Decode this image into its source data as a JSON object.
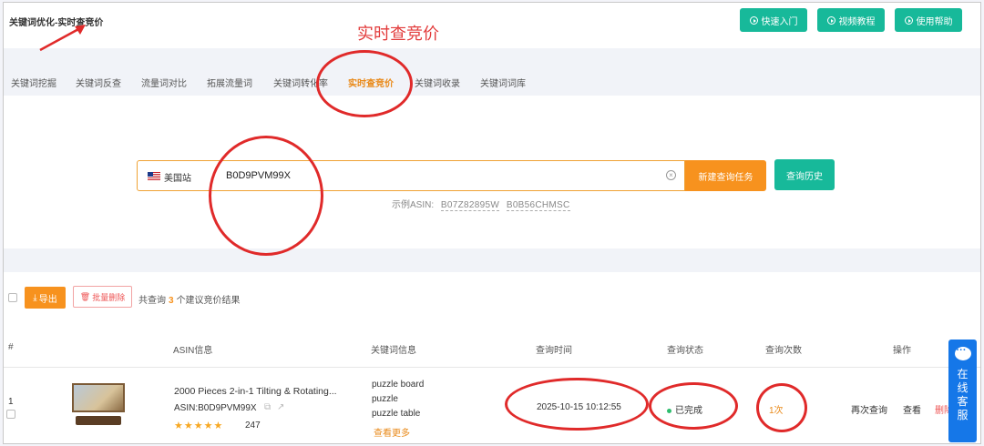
{
  "breadcrumb": "关键词优化-实时查竞价",
  "header_buttons": [
    {
      "label": "快速入门"
    },
    {
      "label": "视频教程"
    },
    {
      "label": "使用帮助"
    }
  ],
  "annotation_title": "实时查竞价",
  "tabs": [
    {
      "label": "关键词挖掘"
    },
    {
      "label": "关键词反查"
    },
    {
      "label": "流量词对比"
    },
    {
      "label": "拓展流量词"
    },
    {
      "label": "关键词转化率"
    },
    {
      "label": "实时查竞价",
      "active": true
    },
    {
      "label": "关键词收录"
    },
    {
      "label": "关键词词库"
    }
  ],
  "search": {
    "site": "美国站",
    "value": "B0D9PVM99X",
    "new_task_label": "新建查询任务",
    "history_label": "查询历史",
    "examples_label": "示例ASIN:",
    "examples": [
      "B07Z82895W",
      "B0B56CHMSC"
    ]
  },
  "actions": {
    "export_label": "导出",
    "batch_delete_label": "批量删除",
    "count_prefix": "共查询",
    "count": "3",
    "count_suffix": "个建议竞价结果"
  },
  "table": {
    "headers": {
      "index": "#",
      "asin": "ASIN信息",
      "keywords": "关键词信息",
      "time": "查询时间",
      "status": "查询状态",
      "times": "查询次数",
      "ops": "操作"
    },
    "rows": [
      {
        "index": "1",
        "title": "2000 Pieces 2-in-1 Tilting & Rotating...",
        "asin": "ASIN:B0D9PVM99X",
        "rating": 4.5,
        "stars": "★★★★★",
        "reviews": "247",
        "keywords": [
          "puzzle board",
          "puzzle",
          "puzzle table"
        ],
        "more_label": "查看更多",
        "time": "2025-10-15 10:12:55",
        "status": "已完成",
        "times": "1次",
        "op_requery": "再次查询",
        "op_view": "查看",
        "op_delete": "删除"
      }
    ]
  },
  "chat": {
    "label": "在线客服"
  },
  "colors": {
    "accent_green": "#17b99a",
    "accent_orange": "#f7921e",
    "annotation_red": "#e02a2a",
    "chat_blue": "#1577e8"
  }
}
